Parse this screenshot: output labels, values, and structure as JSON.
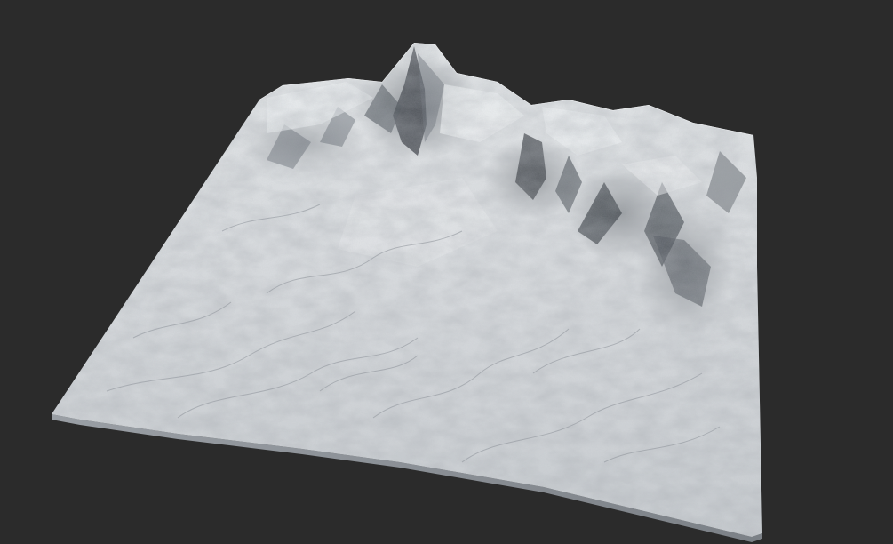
{
  "viewport": {
    "background_color": "#2b2b2b"
  },
  "terrain": {
    "material_color": "#d6dadd",
    "highlight_color": "#eef1f3",
    "shadow_color": "#5a5f66",
    "deep_shadow_color": "#3a3e44"
  }
}
